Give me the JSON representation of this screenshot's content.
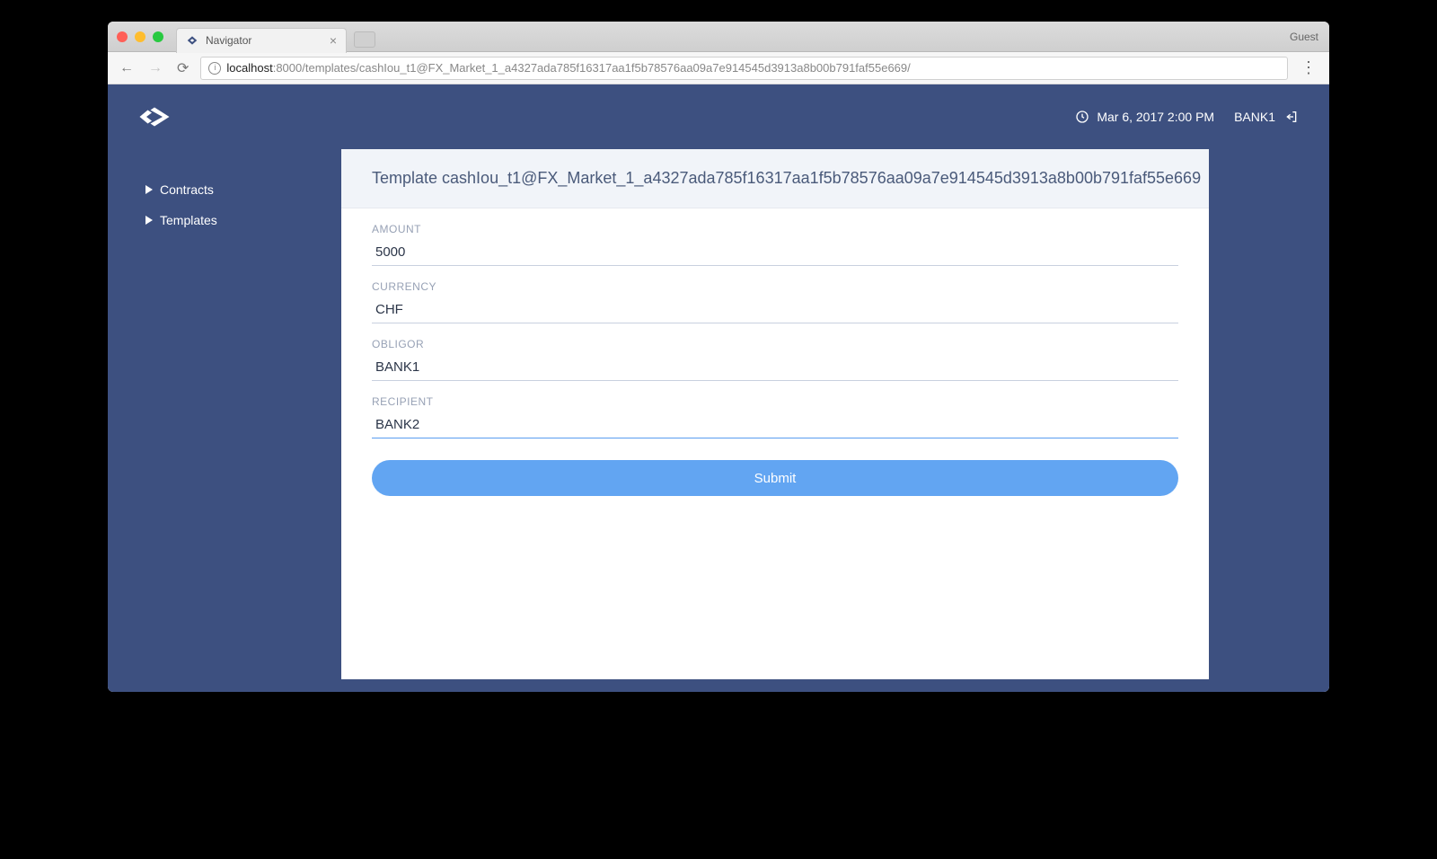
{
  "browser": {
    "tab_title": "Navigator",
    "guest_label": "Guest",
    "address_host": "localhost",
    "address_path": ":8000/templates/cashIou_t1@FX_Market_1_a4327ada785f16317aa1f5b78576aa09a7e914545d3913a8b00b791faf55e669/"
  },
  "header": {
    "datetime": "Mar 6, 2017 2:00 PM",
    "user": "BANK1"
  },
  "sidebar": {
    "items": [
      {
        "label": "Contracts"
      },
      {
        "label": "Templates"
      }
    ]
  },
  "main": {
    "title": "Template cashIou_t1@FX_Market_1_a4327ada785f16317aa1f5b78576aa09a7e914545d3913a8b00b791faf55e669",
    "fields": {
      "amount": {
        "label": "AMOUNT",
        "value": "5000"
      },
      "currency": {
        "label": "CURRENCY",
        "value": "CHF"
      },
      "obligor": {
        "label": "OBLIGOR",
        "value": "BANK1"
      },
      "recipient": {
        "label": "RECIPIENT",
        "value": "BANK2"
      }
    },
    "submit_label": "Submit"
  }
}
